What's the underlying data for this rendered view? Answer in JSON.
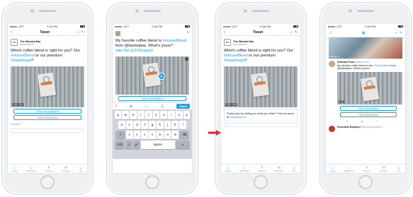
{
  "colors": {
    "accent": "#1da1f2",
    "muted": "#8899a6",
    "arrow": "#e0243b"
  },
  "status": {
    "carrier": "●●●●○ ATT",
    "time": "2:56 PM",
    "battery": "100%"
  },
  "phone1": {
    "nav": {
      "back": "‹",
      "title": "Tweet"
    },
    "author": {
      "avatar": "BB",
      "name": "The Barista Bar",
      "handle": "@baristabar"
    },
    "tweet": {
      "t1": "Which coffee blend is right for you? Our ",
      "h1": "#HouseBlend",
      "t2": " or our premium ",
      "h2": "#DarkRoast",
      "t3": "?"
    },
    "video_time": "0:00 / 0:30",
    "buttons": [
      "Tweet #HouseBlend",
      "Tweet #DarkRoast"
    ],
    "promoted": "Promoted",
    "tabs": [
      "Home",
      "Notifications",
      "Moments",
      "Messages",
      "Me"
    ]
  },
  "phone2": {
    "compose": {
      "l1": "My favorite coffee blend is",
      "h": "#HouseBlend",
      "l2": " from @baristabar.",
      "l3": "What's yours? ",
      "link": "http://bit.ly/1PjKaqwD"
    },
    "card_peek": "Tweet #HouseBlend",
    "tweet_button": "Tweet",
    "keyboard": {
      "row1": [
        "q",
        "w",
        "e",
        "r",
        "t",
        "y",
        "u",
        "i",
        "o",
        "p"
      ],
      "row2": [
        "a",
        "s",
        "d",
        "f",
        "g",
        "h",
        "j",
        "k",
        "l"
      ],
      "row3": [
        "z",
        "x",
        "c",
        "v",
        "b",
        "n",
        "m"
      ],
      "shift": "⇧",
      "delete": "⌫",
      "num": "123",
      "emoji": "☺",
      "mic": "🎤",
      "space": "space",
      "return": "#"
    }
  },
  "phone3": {
    "nav": {
      "back": "‹",
      "title": "Tweet"
    },
    "author": {
      "avatar": "BB",
      "name": "The Barista Bar",
      "handle": "@baristabar"
    },
    "tweet": {
      "t1": "Which coffee blend is right for you? Our ",
      "h1": "#HouseBlend",
      "t2": " or our premium ",
      "h2": "#DarkRoast",
      "t3": "?"
    },
    "video_time": "0:00 / 0:30",
    "reply": {
      "t": "Thank you for telling us what you think. Find out more at ",
      "link": "baristabar.co"
    },
    "tabs": [
      "Home",
      "Notifications",
      "Moments",
      "Messages",
      "Me"
    ]
  },
  "phone4": {
    "img_label": "Chicago, IL",
    "tweet1": {
      "name": "Kristina Frost",
      "handle": "@kfrost",
      "time": "3m",
      "text1": "My favorite coffee blend is the ",
      "h": "#HouseBlend",
      "text2": " from @baristabar. What's yours?"
    },
    "video_time": "0:00",
    "buttons": [
      "Tweet #HouseBlend",
      "Tweet #DarkRoast"
    ],
    "tweet2": {
      "name": "Essential Explorer",
      "handle": "@EssentExplorer"
    },
    "tabs": [
      "Home",
      "Notifications",
      "Moments",
      "Messages",
      "Me"
    ]
  }
}
